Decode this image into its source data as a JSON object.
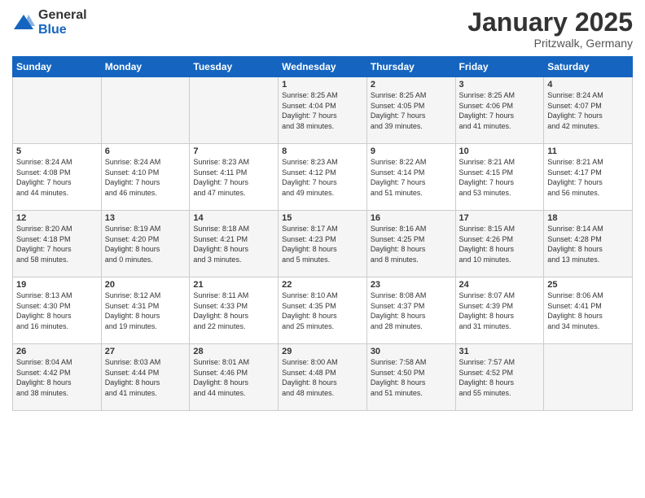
{
  "logo": {
    "general": "General",
    "blue": "Blue"
  },
  "title": "January 2025",
  "subtitle": "Pritzwalk, Germany",
  "days_header": [
    "Sunday",
    "Monday",
    "Tuesday",
    "Wednesday",
    "Thursday",
    "Friday",
    "Saturday"
  ],
  "weeks": [
    [
      {
        "day": "",
        "info": ""
      },
      {
        "day": "",
        "info": ""
      },
      {
        "day": "",
        "info": ""
      },
      {
        "day": "1",
        "info": "Sunrise: 8:25 AM\nSunset: 4:04 PM\nDaylight: 7 hours\nand 38 minutes."
      },
      {
        "day": "2",
        "info": "Sunrise: 8:25 AM\nSunset: 4:05 PM\nDaylight: 7 hours\nand 39 minutes."
      },
      {
        "day": "3",
        "info": "Sunrise: 8:25 AM\nSunset: 4:06 PM\nDaylight: 7 hours\nand 41 minutes."
      },
      {
        "day": "4",
        "info": "Sunrise: 8:24 AM\nSunset: 4:07 PM\nDaylight: 7 hours\nand 42 minutes."
      }
    ],
    [
      {
        "day": "5",
        "info": "Sunrise: 8:24 AM\nSunset: 4:08 PM\nDaylight: 7 hours\nand 44 minutes."
      },
      {
        "day": "6",
        "info": "Sunrise: 8:24 AM\nSunset: 4:10 PM\nDaylight: 7 hours\nand 46 minutes."
      },
      {
        "day": "7",
        "info": "Sunrise: 8:23 AM\nSunset: 4:11 PM\nDaylight: 7 hours\nand 47 minutes."
      },
      {
        "day": "8",
        "info": "Sunrise: 8:23 AM\nSunset: 4:12 PM\nDaylight: 7 hours\nand 49 minutes."
      },
      {
        "day": "9",
        "info": "Sunrise: 8:22 AM\nSunset: 4:14 PM\nDaylight: 7 hours\nand 51 minutes."
      },
      {
        "day": "10",
        "info": "Sunrise: 8:21 AM\nSunset: 4:15 PM\nDaylight: 7 hours\nand 53 minutes."
      },
      {
        "day": "11",
        "info": "Sunrise: 8:21 AM\nSunset: 4:17 PM\nDaylight: 7 hours\nand 56 minutes."
      }
    ],
    [
      {
        "day": "12",
        "info": "Sunrise: 8:20 AM\nSunset: 4:18 PM\nDaylight: 7 hours\nand 58 minutes."
      },
      {
        "day": "13",
        "info": "Sunrise: 8:19 AM\nSunset: 4:20 PM\nDaylight: 8 hours\nand 0 minutes."
      },
      {
        "day": "14",
        "info": "Sunrise: 8:18 AM\nSunset: 4:21 PM\nDaylight: 8 hours\nand 3 minutes."
      },
      {
        "day": "15",
        "info": "Sunrise: 8:17 AM\nSunset: 4:23 PM\nDaylight: 8 hours\nand 5 minutes."
      },
      {
        "day": "16",
        "info": "Sunrise: 8:16 AM\nSunset: 4:25 PM\nDaylight: 8 hours\nand 8 minutes."
      },
      {
        "day": "17",
        "info": "Sunrise: 8:15 AM\nSunset: 4:26 PM\nDaylight: 8 hours\nand 10 minutes."
      },
      {
        "day": "18",
        "info": "Sunrise: 8:14 AM\nSunset: 4:28 PM\nDaylight: 8 hours\nand 13 minutes."
      }
    ],
    [
      {
        "day": "19",
        "info": "Sunrise: 8:13 AM\nSunset: 4:30 PM\nDaylight: 8 hours\nand 16 minutes."
      },
      {
        "day": "20",
        "info": "Sunrise: 8:12 AM\nSunset: 4:31 PM\nDaylight: 8 hours\nand 19 minutes."
      },
      {
        "day": "21",
        "info": "Sunrise: 8:11 AM\nSunset: 4:33 PM\nDaylight: 8 hours\nand 22 minutes."
      },
      {
        "day": "22",
        "info": "Sunrise: 8:10 AM\nSunset: 4:35 PM\nDaylight: 8 hours\nand 25 minutes."
      },
      {
        "day": "23",
        "info": "Sunrise: 8:08 AM\nSunset: 4:37 PM\nDaylight: 8 hours\nand 28 minutes."
      },
      {
        "day": "24",
        "info": "Sunrise: 8:07 AM\nSunset: 4:39 PM\nDaylight: 8 hours\nand 31 minutes."
      },
      {
        "day": "25",
        "info": "Sunrise: 8:06 AM\nSunset: 4:41 PM\nDaylight: 8 hours\nand 34 minutes."
      }
    ],
    [
      {
        "day": "26",
        "info": "Sunrise: 8:04 AM\nSunset: 4:42 PM\nDaylight: 8 hours\nand 38 minutes."
      },
      {
        "day": "27",
        "info": "Sunrise: 8:03 AM\nSunset: 4:44 PM\nDaylight: 8 hours\nand 41 minutes."
      },
      {
        "day": "28",
        "info": "Sunrise: 8:01 AM\nSunset: 4:46 PM\nDaylight: 8 hours\nand 44 minutes."
      },
      {
        "day": "29",
        "info": "Sunrise: 8:00 AM\nSunset: 4:48 PM\nDaylight: 8 hours\nand 48 minutes."
      },
      {
        "day": "30",
        "info": "Sunrise: 7:58 AM\nSunset: 4:50 PM\nDaylight: 8 hours\nand 51 minutes."
      },
      {
        "day": "31",
        "info": "Sunrise: 7:57 AM\nSunset: 4:52 PM\nDaylight: 8 hours\nand 55 minutes."
      },
      {
        "day": "",
        "info": ""
      }
    ]
  ]
}
